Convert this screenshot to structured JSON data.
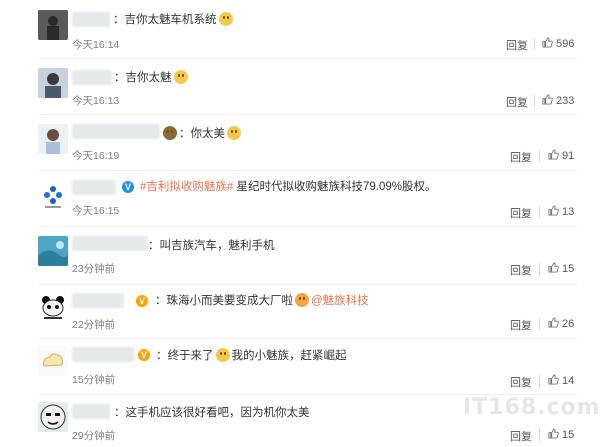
{
  "colors": {
    "accent": "#eb7350",
    "muted": "#808080"
  },
  "comments": [
    {
      "content": "：吉你太魅车机系统",
      "time": "今天16:14",
      "reply": "回复",
      "likes": "596"
    },
    {
      "content": "：吉你太魅",
      "time": "今天16:13",
      "reply": "回复",
      "likes": "233"
    },
    {
      "content": "：你太美",
      "time": "今天16:19",
      "reply": "回复",
      "likes": "91"
    },
    {
      "topic": "#吉利拟收购魅族#",
      "content": " 星纪时代拟收购魅族科技79.09%股权。",
      "time": "今天16:15",
      "reply": "回复",
      "likes": "13"
    },
    {
      "content": "：叫吉族汽车，魅利手机",
      "time": "23分钟前",
      "reply": "回复",
      "likes": "15"
    },
    {
      "content": "：珠海小而美要变成大厂啦",
      "mention": "@魅族科技",
      "time": "22分钟前",
      "reply": "回复",
      "likes": "26"
    },
    {
      "content": "：终于来了",
      "content2": "我的小魅族，赶紧崛起",
      "time": "15分钟前",
      "reply": "回复",
      "likes": "14"
    },
    {
      "content": "：这手机应该很好看吧，因为机你太美",
      "time": "29分钟前",
      "reply": "回复",
      "likes": "15"
    }
  ],
  "watermark": "IT168.com"
}
